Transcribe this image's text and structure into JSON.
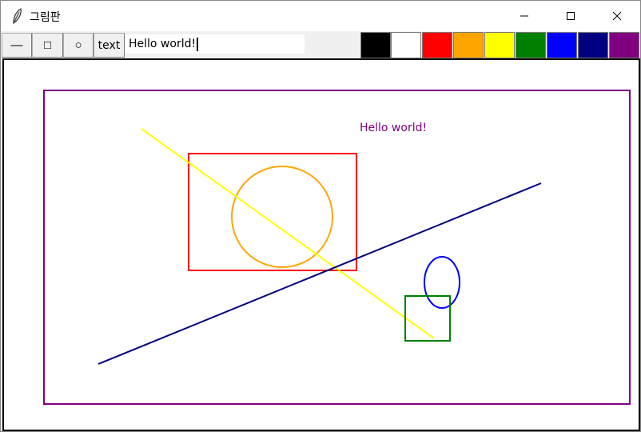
{
  "window": {
    "title": "그림판",
    "icon": "feather-icon"
  },
  "title_buttons": {
    "minimize_icon": "minimize-icon",
    "maximize_icon": "maximize-icon",
    "close_icon": "close-icon"
  },
  "toolbar": {
    "line_label": "—",
    "rect_label": "□",
    "oval_label": "○",
    "text_label": "text",
    "text_input_value": "Hello world!"
  },
  "palette": {
    "colors": [
      "#000000",
      "#ffffff",
      "#ff0000",
      "#ffa500",
      "#ffff00",
      "#008000",
      "#0000ff",
      "#000080",
      "#800080"
    ]
  },
  "canvas": {
    "text_item": "Hello world!",
    "colors": {
      "frame": "#800080",
      "yellow_line": "#ffff00",
      "red_rect": "#ff0000",
      "orange_circle": "#ffa500",
      "navy_line": "#000080",
      "blue_oval": "#0000ff",
      "green_rect": "#008000",
      "text": "#800080"
    }
  }
}
